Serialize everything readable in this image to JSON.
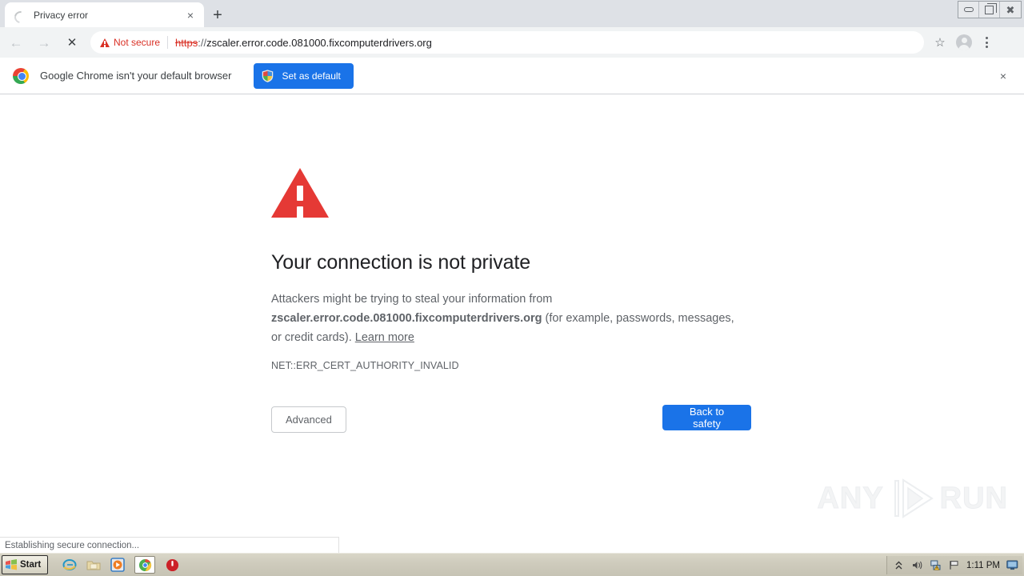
{
  "window": {
    "controls": {
      "minimize": "Minimize",
      "restore": "Restore",
      "close": "Close"
    }
  },
  "tabstrip": {
    "tabs": [
      {
        "title": "Privacy error",
        "favicon": "loading-spinner-icon",
        "close_label": "×"
      }
    ],
    "new_tab_label": "+"
  },
  "toolbar": {
    "back_label": "←",
    "forward_label": "→",
    "stop_label": "✕",
    "security_badge": "Not secure",
    "url": {
      "scheme": "https",
      "separator": "://",
      "host": "zscaler.error.code.081000.fixcomputerdrivers.org"
    },
    "bookmark_label": "☆",
    "profile_label": "Profile",
    "menu_label": "Customize and control Google Chrome"
  },
  "notification": {
    "message": "Google Chrome isn't your default browser",
    "button_label": "Set as default",
    "close_label": "×"
  },
  "interstitial": {
    "icon": "red-warning-triangle-icon",
    "title": "Your connection is not private",
    "body_line1": "Attackers might be trying to steal your information from",
    "body_host": "zscaler.error.code.081000.fixcomputerdrivers.org",
    "body_line2": " (for example, passwords, messages, or credit cards). ",
    "learn_more": "Learn more",
    "error_code": "NET::ERR_CERT_AUTHORITY_INVALID",
    "advanced_label": "Advanced",
    "back_to_safety_label": "Back to safety"
  },
  "watermark": {
    "left_text": "ANY",
    "right_text": "RUN"
  },
  "status_bubble": {
    "text": "Establishing secure connection..."
  },
  "taskbar": {
    "start_label": "Start",
    "quick_launch": [
      {
        "name": "internet-explorer-icon"
      },
      {
        "name": "file-explorer-icon"
      },
      {
        "name": "media-player-icon"
      },
      {
        "name": "google-chrome-icon"
      },
      {
        "name": "shutdown-icon"
      }
    ],
    "tray": {
      "show_hidden_label": "«",
      "volume_label": "Volume",
      "network_label": "Network",
      "flag_label": "Security alerts",
      "time": "1:11 PM",
      "display_label": "Display"
    }
  },
  "colors": {
    "chrome_blue": "#1a73e8",
    "error_red": "#e53935",
    "not_secure_red": "#d93025",
    "tabstrip_bg": "#dee1e6",
    "toolbar_bg": "#f1f3f4",
    "taskbar_bg": "#cfccbd"
  }
}
